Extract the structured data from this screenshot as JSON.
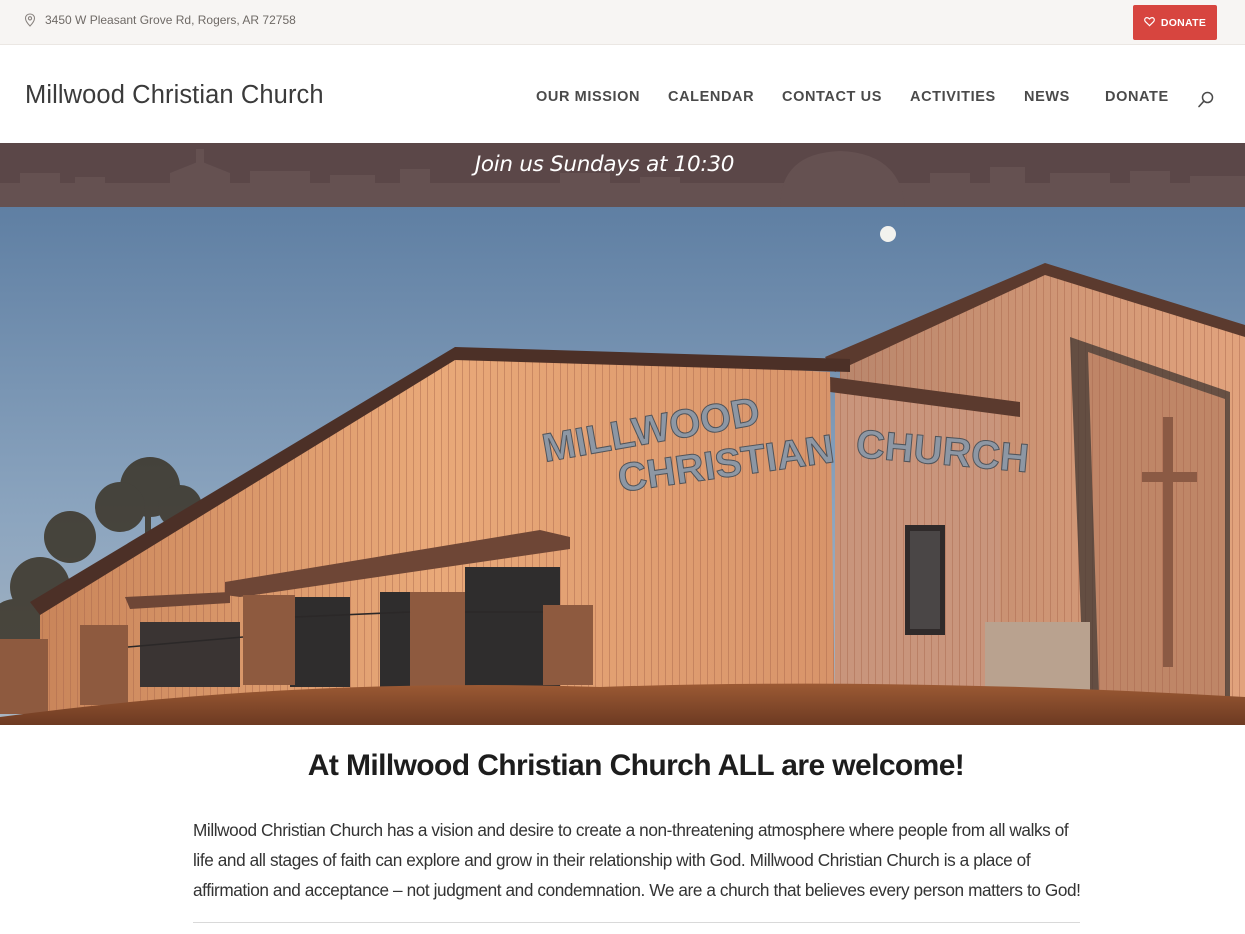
{
  "topbar": {
    "address": "3450 W Pleasant Grove Rd, Rogers, AR 72758",
    "address_icon": "map-pin-icon",
    "donate_label": "DONATE",
    "donate_icon": "heart-icon",
    "donate_color": "#d7453f"
  },
  "header": {
    "site_title": "Millwood Christian Church",
    "nav": [
      {
        "label": "OUR MISSION"
      },
      {
        "label": "CALENDAR"
      },
      {
        "label": "CONTACT US"
      },
      {
        "label": "ACTIVITIES"
      },
      {
        "label": "NEWS"
      },
      {
        "label": "DONATE"
      }
    ],
    "search_icon": "search-icon"
  },
  "band": {
    "text": "Join us Sundays at 10:30",
    "color": "#5b4748"
  },
  "hero": {
    "sign_line1": "MILLWOOD",
    "sign_line2": "CHRISTIAN",
    "sign_line3": "CHURCH"
  },
  "content": {
    "headline": "At Millwood Christian Church ALL are welcome!",
    "paragraph": "Millwood Christian Church has a vision and desire to create a non-threatening atmosphere where people from all walks of life and all stages of faith can explore and grow in their relationship with God. Millwood Christian Church is a place of affirmation and acceptance – not judgment and condemnation. We are a church that believes every person matters to God!"
  }
}
